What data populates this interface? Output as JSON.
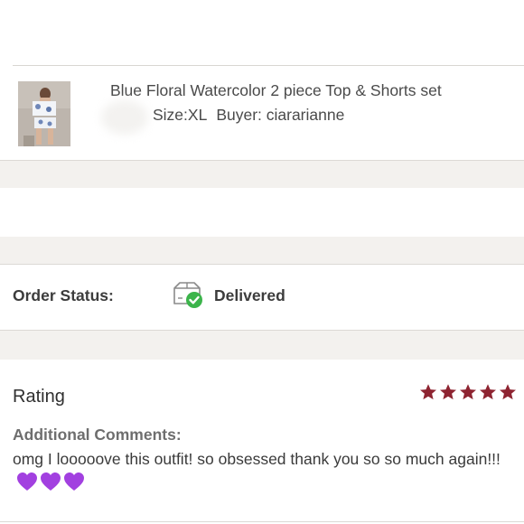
{
  "order_item": {
    "title": "Blue Floral Watercolor 2 piece Top & Shorts set",
    "size": "Size:XL",
    "buyer": "Buyer: ciararianne",
    "thumbnail_icon": "product-photo"
  },
  "order_status": {
    "label": "Order Status:",
    "value": "Delivered",
    "icon": "delivered-box-check-icon",
    "check_color": "#3cb44b"
  },
  "rating": {
    "label": "Rating",
    "stars": 5,
    "max_stars": 5,
    "star_color": "#8e2431"
  },
  "comments": {
    "label": "Additional Comments:",
    "text": "omg I looooove this outfit! so obsessed thank you so so much again!!!",
    "emoji": "💜💜💜",
    "emoji_color": "#a240e0"
  }
}
